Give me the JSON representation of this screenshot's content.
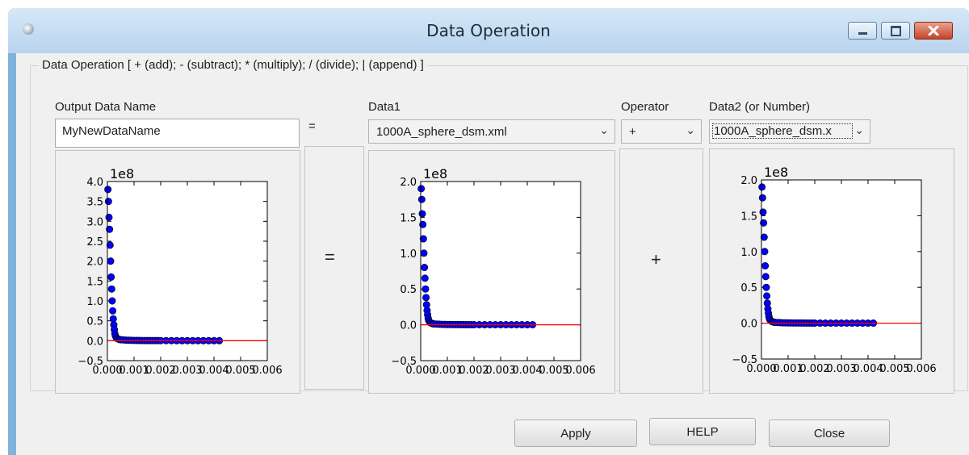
{
  "window": {
    "title": "Data Operation"
  },
  "group": {
    "title": "Data Operation [ + (add); - (subtract); * (multiply); / (divide); | (append) ]"
  },
  "output": {
    "label": "Output Data Name",
    "value": "MyNewDataName"
  },
  "equals_small": "=",
  "equals_big": "=",
  "data1": {
    "label": "Data1",
    "selected": "1000A_sphere_dsm.xml"
  },
  "operator": {
    "label": "Operator",
    "selected": "+",
    "display": "+"
  },
  "data2": {
    "label": "Data2 (or Number)",
    "selected": "1000A_sphere_dsm.x"
  },
  "buttons": {
    "apply": "Apply",
    "help": "HELP",
    "close": "Close"
  },
  "icons": {
    "chevron": "⌄",
    "minimize": "minimize-icon",
    "restore": "restore-icon",
    "close": "close-icon"
  },
  "colors": {
    "marker": "#0000ff",
    "line": "#ff0000"
  },
  "chart_data": [
    {
      "type": "scatter",
      "title": "",
      "offset_text": "1e8",
      "yticks": [
        "4.0",
        "3.5",
        "3.0",
        "2.5",
        "2.0",
        "1.5",
        "1.0",
        "0.5",
        "0.0",
        "−0.5"
      ],
      "xticks": [
        "0.000",
        "0.001",
        "0.002",
        "0.003",
        "0.004",
        "0.005",
        "0.006"
      ],
      "xlim": [
        0,
        0.006
      ],
      "ylim": [
        -0.5,
        4.0
      ],
      "x": [
        2e-05,
        4e-05,
        6e-05,
        8e-05,
        0.0001,
        0.00012,
        0.00014,
        0.00016,
        0.00018,
        0.0002,
        0.00022,
        0.00024,
        0.00026,
        0.00028,
        0.0003,
        0.00034,
        0.00038,
        0.00042,
        0.00046,
        0.0005,
        0.0006,
        0.0007,
        0.0008,
        0.0009,
        0.001,
        0.0011,
        0.0012,
        0.0013,
        0.0014,
        0.0015,
        0.0016,
        0.0017,
        0.0018,
        0.0019,
        0.002,
        0.0022,
        0.0024,
        0.0026,
        0.0028,
        0.003,
        0.0032,
        0.0034,
        0.0036,
        0.0038,
        0.004,
        0.0042
      ],
      "y": [
        3.8,
        3.5,
        3.1,
        2.8,
        2.4,
        2.0,
        1.6,
        1.3,
        1.0,
        0.75,
        0.55,
        0.4,
        0.28,
        0.18,
        0.12,
        0.07,
        0.05,
        0.04,
        0.03,
        0.025,
        0.02,
        0.015,
        0.012,
        0.01,
        0.008,
        0.007,
        0.006,
        0.005,
        0.005,
        0.004,
        0.004,
        0.003,
        0.003,
        0.003,
        0.002,
        0.002,
        0.002,
        0.001,
        0.001,
        0.001,
        0.001,
        0.001,
        0.001,
        0.001,
        0.001,
        0.001
      ],
      "hline": 0.0
    },
    {
      "type": "scatter",
      "title": "",
      "offset_text": "1e8",
      "yticks": [
        "2.0",
        "1.5",
        "1.0",
        "0.5",
        "0.0",
        "−0.5"
      ],
      "xticks": [
        "0.000",
        "0.001",
        "0.002",
        "0.003",
        "0.004",
        "0.005",
        "0.006"
      ],
      "xlim": [
        0,
        0.006
      ],
      "ylim": [
        -0.5,
        2.0
      ],
      "x": [
        2e-05,
        4e-05,
        6e-05,
        8e-05,
        0.0001,
        0.00012,
        0.00014,
        0.00016,
        0.00018,
        0.0002,
        0.00022,
        0.00024,
        0.00026,
        0.00028,
        0.0003,
        0.00034,
        0.00038,
        0.00042,
        0.00046,
        0.0005,
        0.0006,
        0.0007,
        0.0008,
        0.0009,
        0.001,
        0.0011,
        0.0012,
        0.0013,
        0.0014,
        0.0015,
        0.0016,
        0.0017,
        0.0018,
        0.0019,
        0.002,
        0.0022,
        0.0024,
        0.0026,
        0.0028,
        0.003,
        0.0032,
        0.0034,
        0.0036,
        0.0038,
        0.004,
        0.0042
      ],
      "y": [
        1.9,
        1.75,
        1.55,
        1.4,
        1.2,
        1.0,
        0.8,
        0.65,
        0.5,
        0.38,
        0.28,
        0.2,
        0.14,
        0.09,
        0.06,
        0.035,
        0.025,
        0.02,
        0.015,
        0.012,
        0.01,
        0.008,
        0.006,
        0.005,
        0.004,
        0.0035,
        0.003,
        0.0025,
        0.0025,
        0.002,
        0.002,
        0.0015,
        0.0015,
        0.0015,
        0.001,
        0.001,
        0.001,
        0.0005,
        0.0005,
        0.0005,
        0.0005,
        0.0005,
        0.0005,
        0.0005,
        0.0005,
        0.0005
      ],
      "hline": 0.0
    },
    {
      "type": "scatter",
      "title": "",
      "offset_text": "1e8",
      "yticks": [
        "2.0",
        "1.5",
        "1.0",
        "0.5",
        "0.0",
        "−0.5"
      ],
      "xticks": [
        "0.000",
        "0.001",
        "0.002",
        "0.003",
        "0.004",
        "0.005",
        "0.006"
      ],
      "xlim": [
        0,
        0.006
      ],
      "ylim": [
        -0.5,
        2.0
      ],
      "x": [
        2e-05,
        4e-05,
        6e-05,
        8e-05,
        0.0001,
        0.00012,
        0.00014,
        0.00016,
        0.00018,
        0.0002,
        0.00022,
        0.00024,
        0.00026,
        0.00028,
        0.0003,
        0.00034,
        0.00038,
        0.00042,
        0.00046,
        0.0005,
        0.0006,
        0.0007,
        0.0008,
        0.0009,
        0.001,
        0.0011,
        0.0012,
        0.0013,
        0.0014,
        0.0015,
        0.0016,
        0.0017,
        0.0018,
        0.0019,
        0.002,
        0.0022,
        0.0024,
        0.0026,
        0.0028,
        0.003,
        0.0032,
        0.0034,
        0.0036,
        0.0038,
        0.004,
        0.0042
      ],
      "y": [
        1.9,
        1.75,
        1.55,
        1.4,
        1.2,
        1.0,
        0.8,
        0.65,
        0.5,
        0.38,
        0.28,
        0.2,
        0.14,
        0.09,
        0.06,
        0.035,
        0.025,
        0.02,
        0.015,
        0.012,
        0.01,
        0.008,
        0.006,
        0.005,
        0.004,
        0.0035,
        0.003,
        0.0025,
        0.0025,
        0.002,
        0.002,
        0.0015,
        0.0015,
        0.0015,
        0.001,
        0.001,
        0.001,
        0.0005,
        0.0005,
        0.0005,
        0.0005,
        0.0005,
        0.0005,
        0.0005,
        0.0005,
        0.0005
      ],
      "hline": 0.0
    }
  ]
}
